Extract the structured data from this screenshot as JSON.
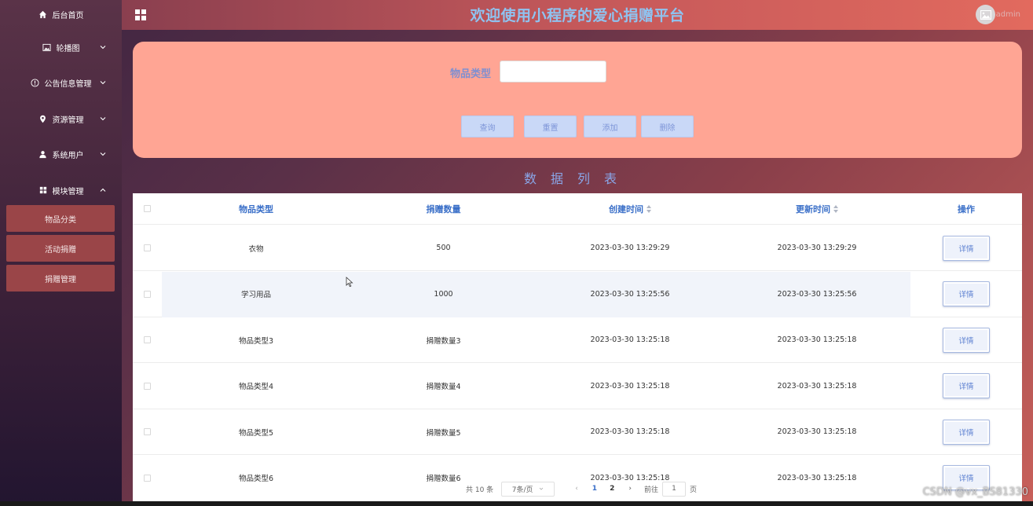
{
  "header": {
    "title": "欢迎使用小程序的爱心捐赠平台",
    "username": "admin"
  },
  "sidebar": {
    "items": [
      {
        "label": "后台首页",
        "icon": "home-icon"
      },
      {
        "label": "轮播图",
        "icon": "image-icon"
      },
      {
        "label": "公告信息管理",
        "icon": "info-circle-icon"
      },
      {
        "label": "资源管理",
        "icon": "location-pin-icon"
      },
      {
        "label": "系统用户",
        "icon": "user-icon"
      },
      {
        "label": "模块管理",
        "icon": "grid-icon"
      }
    ],
    "subitems": [
      "物品分类",
      "活动捐赠",
      "捐赠管理"
    ]
  },
  "search": {
    "filter_label": "物品类型",
    "filter_value": "",
    "buttons": [
      "查询",
      "重置",
      "添加",
      "删除"
    ]
  },
  "table": {
    "section_title": "数据列表",
    "columns": [
      "物品类型",
      "捐赠数量",
      "创建时间",
      "更新时间",
      "操作"
    ],
    "rows": [
      {
        "type": "衣物",
        "qty": "500",
        "created": "2023-03-30 13:29:29",
        "updated": "2023-03-30 13:29:29",
        "action": "详情"
      },
      {
        "type": "学习用品",
        "qty": "1000",
        "created": "2023-03-30 13:25:56",
        "updated": "2023-03-30 13:25:56",
        "action": "详情"
      },
      {
        "type": "物品类型3",
        "qty": "捐赠数量3",
        "created": "2023-03-30 13:25:18",
        "updated": "2023-03-30 13:25:18",
        "action": "详情"
      },
      {
        "type": "物品类型4",
        "qty": "捐赠数量4",
        "created": "2023-03-30 13:25:18",
        "updated": "2023-03-30 13:25:18",
        "action": "详情"
      },
      {
        "type": "物品类型5",
        "qty": "捐赠数量5",
        "created": "2023-03-30 13:25:18",
        "updated": "2023-03-30 13:25:18",
        "action": "详情"
      },
      {
        "type": "物品类型6",
        "qty": "捐赠数量6",
        "created": "2023-03-30 13:25:18",
        "updated": "2023-03-30 13:25:18",
        "action": "详情"
      }
    ]
  },
  "pagination": {
    "total": "共 10 条",
    "page_size": "7条/页",
    "pages": [
      "1",
      "2"
    ],
    "goto_prefix": "前往",
    "goto_value": "1",
    "goto_suffix": "页"
  },
  "watermark": "CSDN @vx_BS81330",
  "colors": {
    "title": "#8fc3f0",
    "panel": "#ffa594",
    "button": "#c9d8f7",
    "submenu": "#9a4548",
    "header_text": "#3a6fc8"
  }
}
